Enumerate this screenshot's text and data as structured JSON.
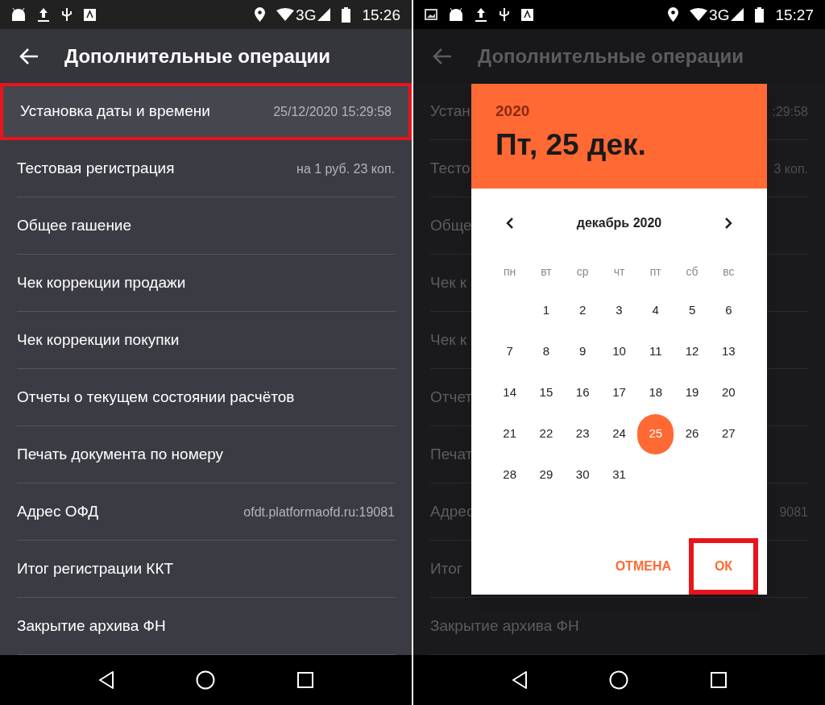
{
  "left_screen": {
    "status_bar": {
      "time": "15:26",
      "network": "3G"
    },
    "app_bar": {
      "title": "Дополнительные операции"
    },
    "items": [
      {
        "label": "Установка даты и времени",
        "value": "25/12/2020 15:29:58",
        "highlighted": true
      },
      {
        "label": "Тестовая регистрация",
        "value": "на 1 руб. 23 коп.",
        "highlighted": false
      },
      {
        "label": "Общее гашение",
        "highlighted": false
      },
      {
        "label": "Чек коррекции продажи",
        "highlighted": false
      },
      {
        "label": "Чек коррекции покупки",
        "highlighted": false
      },
      {
        "label": "Отчеты о текущем состоянии расчётов",
        "highlighted": false
      },
      {
        "label": "Печать документа по номеру",
        "highlighted": false
      },
      {
        "label": "Адрес ОФД",
        "value": "ofdt.platformaofd.ru:19081",
        "highlighted": false
      },
      {
        "label": "Итог регистрации ККТ",
        "highlighted": false
      },
      {
        "label": "Закрытие архива ФН",
        "highlighted": false
      }
    ]
  },
  "right_screen": {
    "status_bar": {
      "time": "15:27",
      "network": "3G"
    },
    "app_bar": {
      "title": "Дополнительные операции"
    },
    "items": [
      {
        "label": "Устан",
        "value": ":29:58"
      },
      {
        "label": "Тесто",
        "value": "3 коп."
      },
      {
        "label": "Обще"
      },
      {
        "label": "Чек к"
      },
      {
        "label": "Чек к"
      },
      {
        "label": "Отчет"
      },
      {
        "label": "Печат"
      },
      {
        "label": "Адрес",
        "value": "9081"
      },
      {
        "label": "Итог"
      },
      {
        "label": "Закрытие архива ФН"
      }
    ],
    "date_dialog": {
      "year": "2020",
      "date": "Пт, 25 дек.",
      "month": "декабрь 2020",
      "weekdays": [
        "пн",
        "вт",
        "ср",
        "чт",
        "пт",
        "сб",
        "вс"
      ],
      "weeks": [
        [
          {
            "kind": "blank"
          },
          {
            "kind": "day",
            "label": "1",
            "selected": false
          },
          {
            "kind": "day",
            "label": "2",
            "selected": false
          },
          {
            "kind": "day",
            "label": "3",
            "selected": false
          },
          {
            "kind": "day",
            "label": "4",
            "selected": false
          },
          {
            "kind": "day",
            "label": "5",
            "selected": false
          },
          {
            "kind": "day",
            "label": "6",
            "selected": false
          }
        ],
        [
          {
            "kind": "day",
            "label": "7",
            "selected": false
          },
          {
            "kind": "day",
            "label": "8",
            "selected": false
          },
          {
            "kind": "day",
            "label": "9",
            "selected": false
          },
          {
            "kind": "day",
            "label": "10",
            "selected": false
          },
          {
            "kind": "day",
            "label": "11",
            "selected": false
          },
          {
            "kind": "day",
            "label": "12",
            "selected": false
          },
          {
            "kind": "day",
            "label": "13",
            "selected": false
          }
        ],
        [
          {
            "kind": "day",
            "label": "14",
            "selected": false
          },
          {
            "kind": "day",
            "label": "15",
            "selected": false
          },
          {
            "kind": "day",
            "label": "16",
            "selected": false
          },
          {
            "kind": "day",
            "label": "17",
            "selected": false
          },
          {
            "kind": "day",
            "label": "18",
            "selected": false
          },
          {
            "kind": "day",
            "label": "19",
            "selected": false
          },
          {
            "kind": "day",
            "label": "20",
            "selected": false
          }
        ],
        [
          {
            "kind": "day",
            "label": "21",
            "selected": false
          },
          {
            "kind": "day",
            "label": "22",
            "selected": false
          },
          {
            "kind": "day",
            "label": "23",
            "selected": false
          },
          {
            "kind": "day",
            "label": "24",
            "selected": false
          },
          {
            "kind": "day",
            "label": "25",
            "selected": true
          },
          {
            "kind": "day",
            "label": "26",
            "selected": false
          },
          {
            "kind": "day",
            "label": "27",
            "selected": false
          }
        ],
        [
          {
            "kind": "day",
            "label": "28",
            "selected": false
          },
          {
            "kind": "day",
            "label": "29",
            "selected": false
          },
          {
            "kind": "day",
            "label": "30",
            "selected": false
          },
          {
            "kind": "day",
            "label": "31",
            "selected": false
          },
          {
            "kind": "blank"
          },
          {
            "kind": "blank"
          },
          {
            "kind": "blank"
          }
        ]
      ],
      "buttons": [
        {
          "label": "ОТМЕНА",
          "highlighted": false
        },
        {
          "label": "ОК",
          "highlighted": true
        }
      ]
    }
  }
}
